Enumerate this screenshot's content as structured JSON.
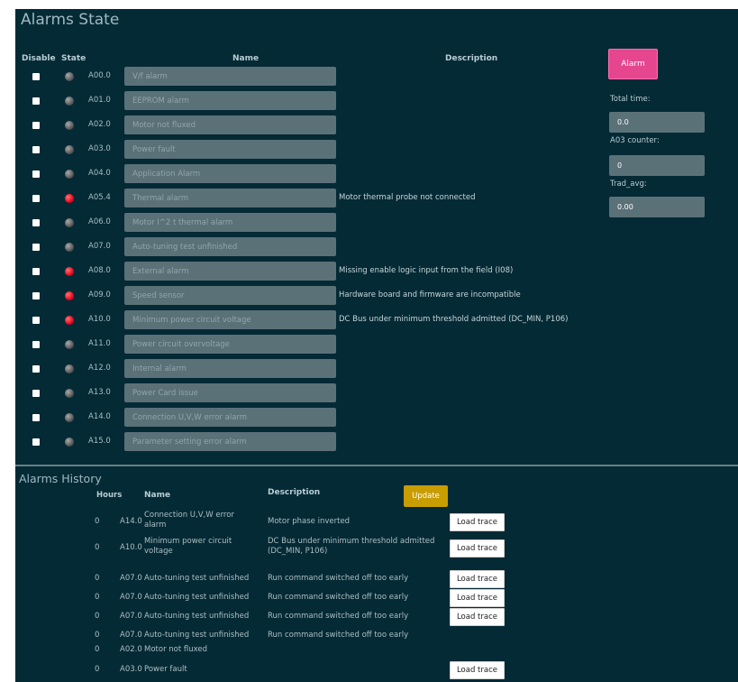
{
  "alarms_state": {
    "title": "Alarms State",
    "headers": {
      "disable": "Disable",
      "state": "State",
      "name": "Name",
      "description": "Description"
    },
    "rows": [
      {
        "code": "A00.0",
        "name": "V/f alarm",
        "description": "",
        "active": false
      },
      {
        "code": "A01.0",
        "name": "EEPROM alarm",
        "description": "",
        "active": false
      },
      {
        "code": "A02.0",
        "name": "Motor not fluxed",
        "description": "",
        "active": false
      },
      {
        "code": "A03.0",
        "name": "Power fault",
        "description": "",
        "active": false
      },
      {
        "code": "A04.0",
        "name": "Application Alarm",
        "description": "",
        "active": false
      },
      {
        "code": "A05.4",
        "name": "Thermal alarm",
        "description": "Motor thermal probe not connected",
        "active": true
      },
      {
        "code": "A06.0",
        "name": "Motor I^2 t thermal alarm",
        "description": "",
        "active": false
      },
      {
        "code": "A07.0",
        "name": "Auto-tuning test unfinished",
        "description": "",
        "active": false
      },
      {
        "code": "A08.0",
        "name": "External alarm",
        "description": "Missing enable logic input from the field (I08)",
        "active": true
      },
      {
        "code": "A09.0",
        "name": "Speed sensor",
        "description": "Hardware board and firmware are incompatible",
        "active": true
      },
      {
        "code": "A10.0",
        "name": "Minimum power circuit voltage",
        "description": "DC Bus under minimum threshold admitted (DC_MIN, P106)",
        "active": true
      },
      {
        "code": "A11.0",
        "name": "Power circuit overvoltage",
        "description": "",
        "active": false
      },
      {
        "code": "A12.0",
        "name": "Internal alarm",
        "description": "",
        "active": false
      },
      {
        "code": "A13.0",
        "name": "Power Card issue",
        "description": "",
        "active": false
      },
      {
        "code": "A14.0",
        "name": "Connection U,V,W error alarm",
        "description": "",
        "active": false
      },
      {
        "code": "A15.0",
        "name": "Parameter setting error alarm",
        "description": "",
        "active": false
      }
    ],
    "colors": {
      "led_active": "#e0001c",
      "led_inactive": "#6e6e6e"
    }
  },
  "side": {
    "alarm_button": "Alarm",
    "total_time_label": "Total time:",
    "total_time_value": "0.0",
    "counter_label": "A03 counter:",
    "counter_value": "0",
    "trad_label": "Trad_avg:",
    "trad_value": "0.00"
  },
  "alarms_history": {
    "title": "Alarms History",
    "headers": {
      "hours": "Hours",
      "name": "Name",
      "description": "Description"
    },
    "update_button": "Update",
    "load_trace_label": "Load trace",
    "rows": [
      {
        "hours": "0",
        "code": "A14.0",
        "name": "Connection U,V,W error alarm",
        "description": "Motor phase inverted",
        "has_trace": true
      },
      {
        "hours": "0",
        "code": "A10.0",
        "name": "Minimum power circuit voltage",
        "description": "DC Bus under minimum threshold admitted (DC_MIN, P106)",
        "has_trace": true
      },
      {
        "hours": "0",
        "code": "A07.0",
        "name": "Auto-tuning test unfinished",
        "description": "Run command switched off too early",
        "has_trace": true
      },
      {
        "hours": "0",
        "code": "A07.0",
        "name": "Auto-tuning test unfinished",
        "description": "Run command switched off too early",
        "has_trace": true
      },
      {
        "hours": "0",
        "code": "A07.0",
        "name": "Auto-tuning test unfinished",
        "description": "Run command switched off too early",
        "has_trace": true
      },
      {
        "hours": "0",
        "code": "A07.0",
        "name": "Auto-tuning test unfinished",
        "description": "Run command switched off too early",
        "has_trace": false
      },
      {
        "hours": "0",
        "code": "A02.0",
        "name": "Motor not fluxed",
        "description": "",
        "has_trace": false
      },
      {
        "hours": "0",
        "code": "A03.0",
        "name": "Power fault",
        "description": "",
        "has_trace": true
      }
    ]
  }
}
